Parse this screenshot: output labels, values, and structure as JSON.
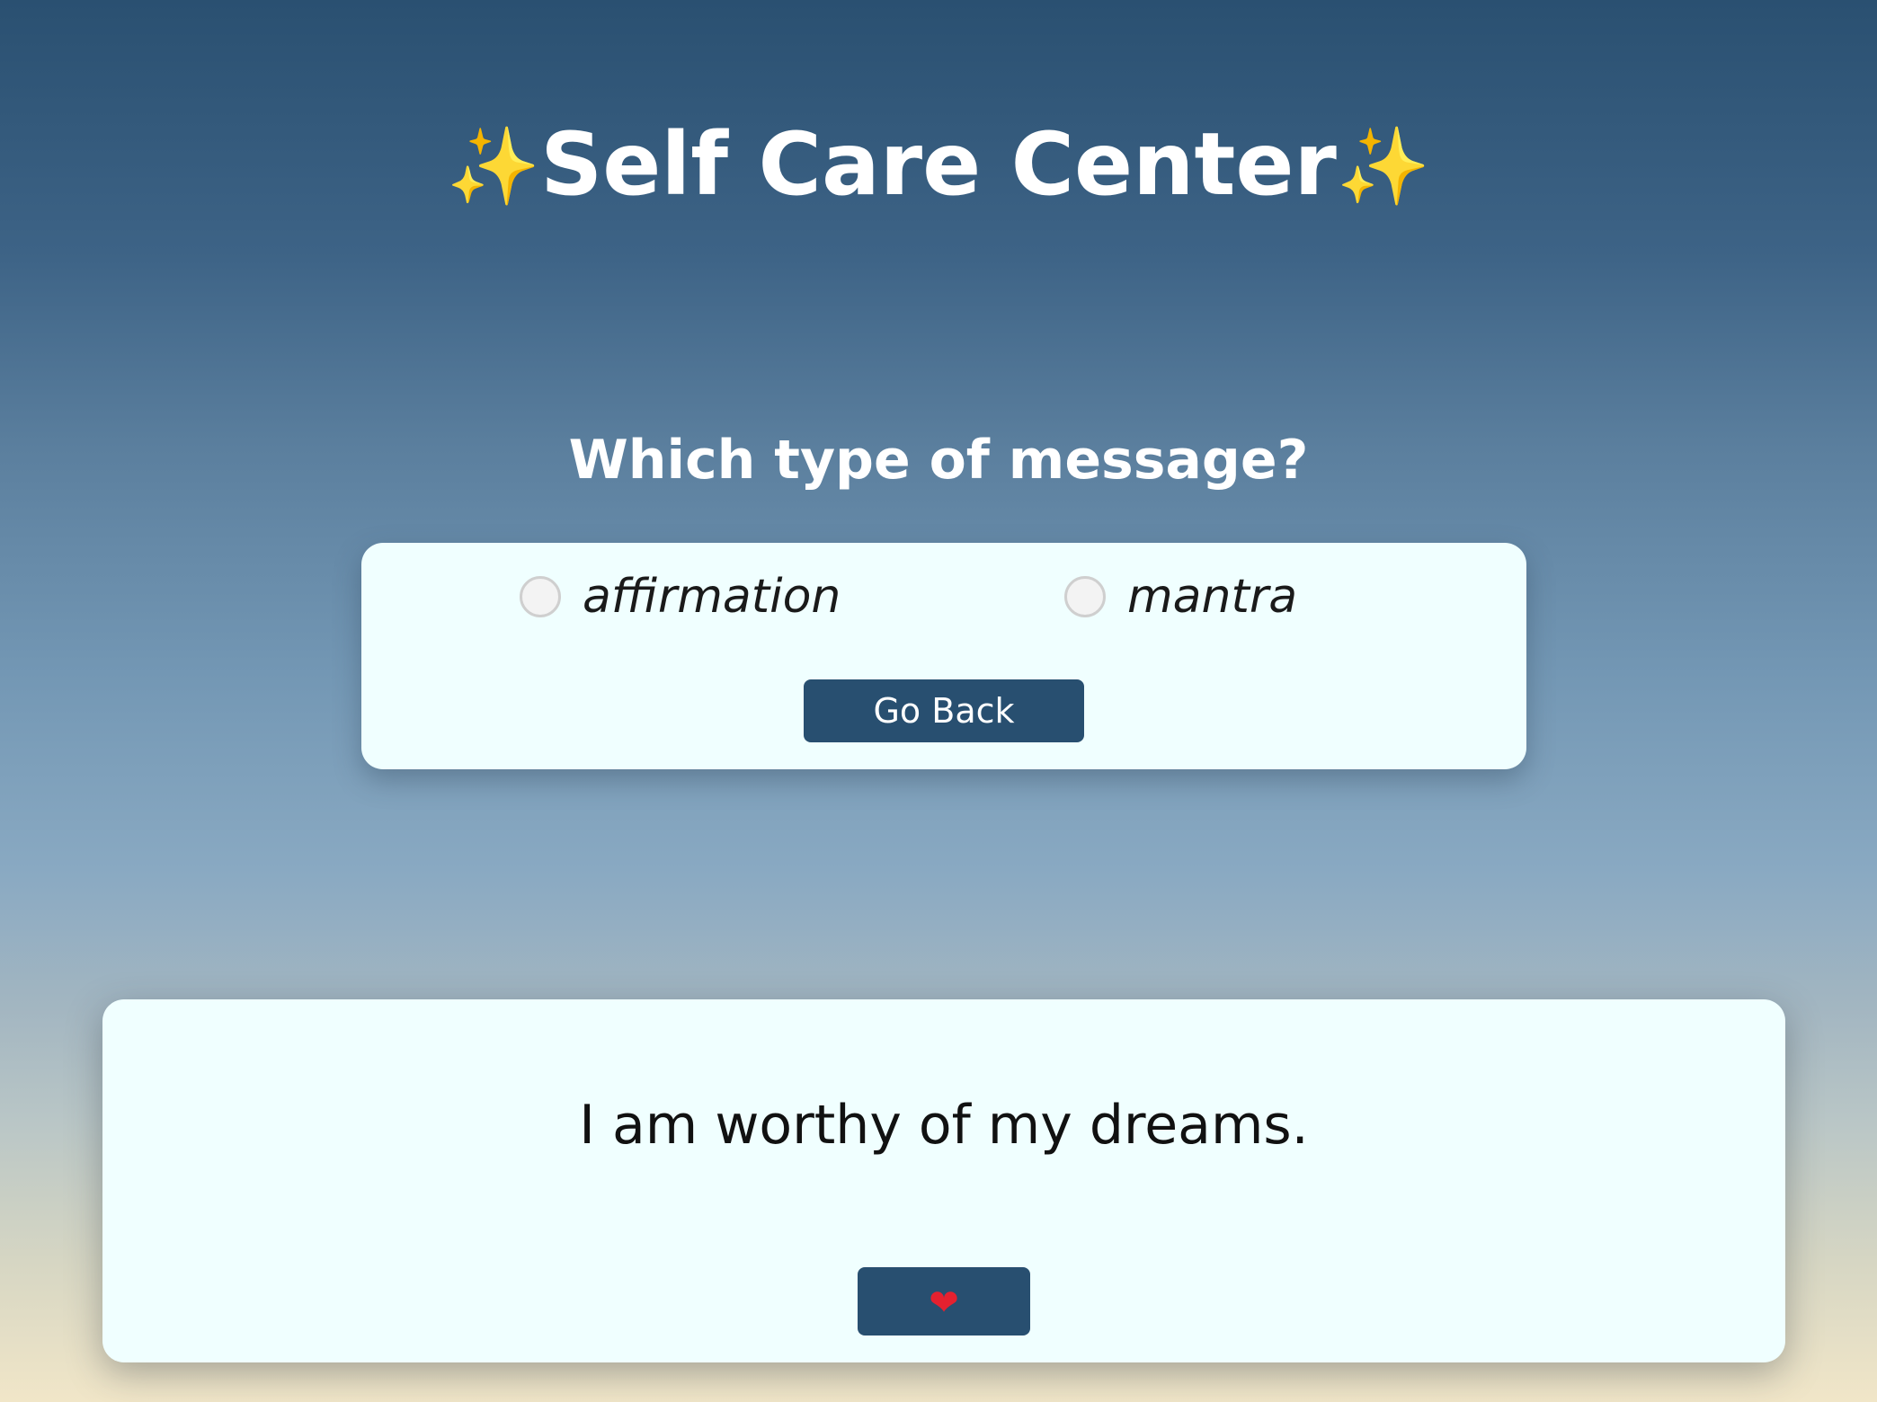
{
  "header": {
    "title": "Self Care Center",
    "sparkle_left": "✨",
    "sparkle_right": "✨"
  },
  "prompt": {
    "question": "Which type of message?"
  },
  "choices": {
    "options": [
      {
        "label": "affirmation",
        "selected": false
      },
      {
        "label": "mantra",
        "selected": false
      }
    ],
    "go_back_label": "Go Back"
  },
  "message": {
    "text": "I am worthy of my dreams.",
    "favorite_icon": "❤",
    "favorite_icon_name": "heart-icon"
  },
  "colors": {
    "button_bg": "#284f70",
    "card_bg": "#f0ffff",
    "heart": "#e5212f",
    "sparkle": "#f7c531"
  }
}
